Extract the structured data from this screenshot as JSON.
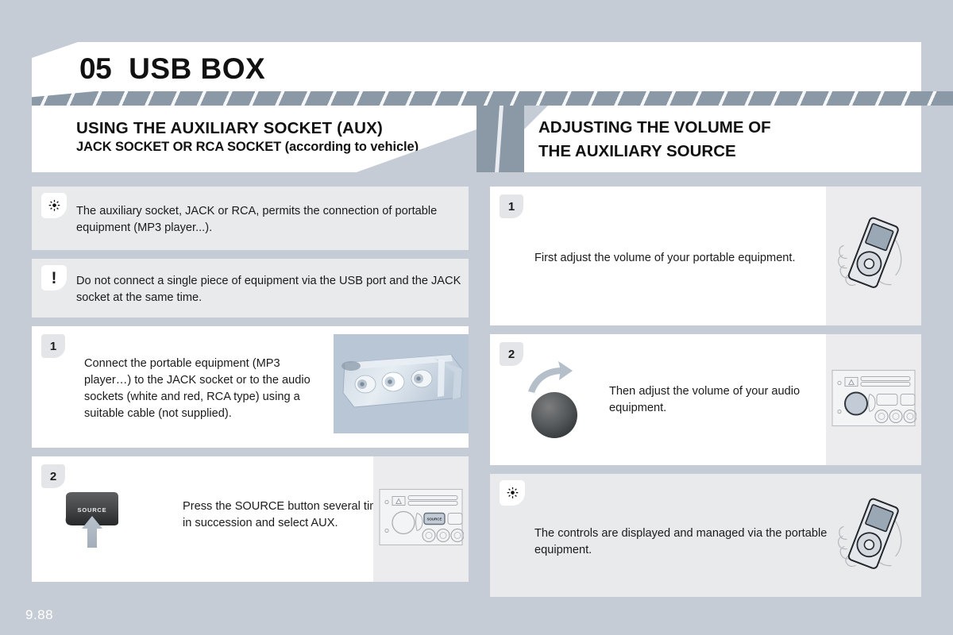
{
  "page": {
    "background_color": "#c6ccd5",
    "number": "9.88"
  },
  "header": {
    "chapter_number": "05",
    "chapter_title": "USB BOX"
  },
  "sections": {
    "left": {
      "title": "USING THE AUXILIARY SOCKET (AUX)",
      "subtitle": "JACK SOCKET OR RCA SOCKET (according to vehicle)"
    },
    "right": {
      "title_line1": "ADJUSTING THE VOLUME OF",
      "title_line2": "THE AUXILIARY SOURCE"
    }
  },
  "left_column": {
    "tip": {
      "icon": "sun-icon",
      "text": "The auxiliary socket, JACK or RCA, permits the connection of portable equipment (MP3 player...)."
    },
    "warning": {
      "icon": "exclamation-icon",
      "text": "Do not connect a single piece of equipment via the USB port and the JACK socket at the same time."
    },
    "step1": {
      "number": "1",
      "text": "Connect the portable equipment (MP3 player…) to the JACK socket or to the audio sockets (white and red, RCA type) using a suitable cable (not supplied).",
      "figure": "aux-socket-photo"
    },
    "step2": {
      "number": "2",
      "text": "Press the SOURCE button several times in succession and select AUX.",
      "button_label": "SOURCE",
      "figure": "car-radio-source-diagram"
    }
  },
  "right_column": {
    "step1": {
      "number": "1",
      "text": "First adjust the volume of your portable equipment.",
      "figure": "hand-holding-mp3-player"
    },
    "step2": {
      "number": "2",
      "text": "Then adjust the volume of your audio equipment.",
      "figure": "car-radio-volume-knob-diagram"
    },
    "tip": {
      "icon": "sun-icon",
      "text": "The controls are displayed and managed via the portable equipment.",
      "figure": "hand-holding-mp3-player"
    }
  },
  "colors": {
    "page_bg": "#c6ccd5",
    "band_gray": "#8b98a6",
    "block_white": "#ffffff",
    "block_grey": "#e9eaec",
    "figure_pane": "#ececee",
    "photo_bg": "#b9c6d5",
    "text": "#1b1b1b"
  }
}
